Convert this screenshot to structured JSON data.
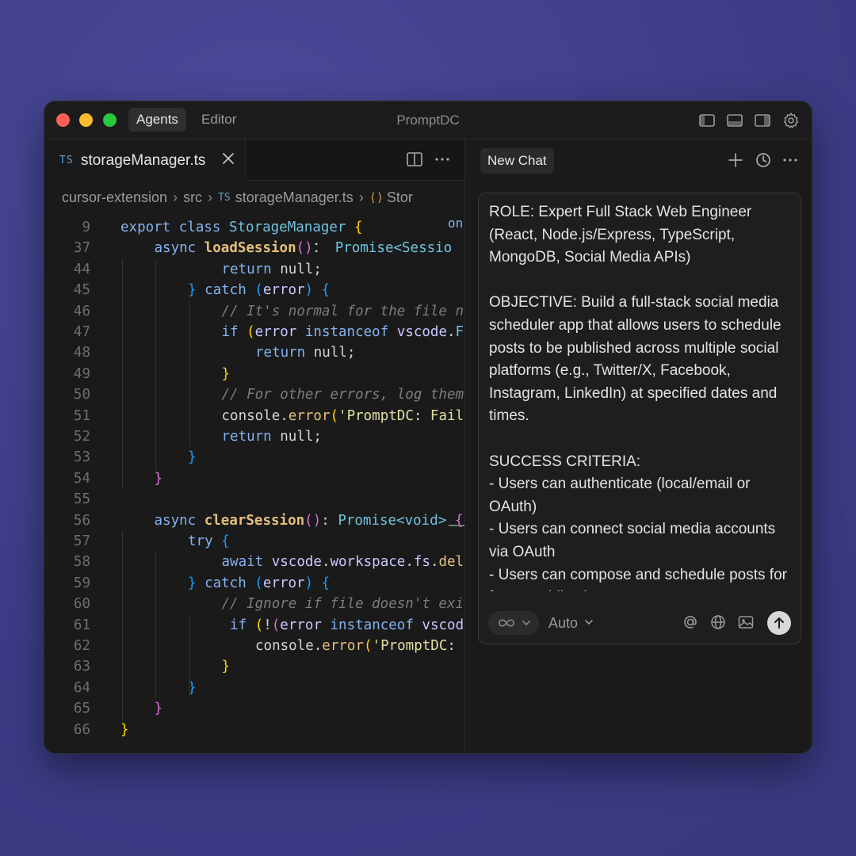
{
  "window": {
    "tabs": [
      "Agents",
      "Editor"
    ],
    "title": "PromptDC",
    "titlebar_icons": [
      "sidebar-left-icon",
      "panel-bottom-icon",
      "sidebar-right-icon",
      "gear-icon"
    ]
  },
  "editor": {
    "file_tab": {
      "badge": "TS",
      "label": "storageManager.ts"
    },
    "breadcrumb": [
      "cursor-extension",
      "src",
      "storageManager.ts",
      "Stor"
    ],
    "overflow_fragment": "on",
    "lines": [
      {
        "n": "9",
        "indent": 0,
        "tokens": [
          [
            "kw",
            "export class "
          ],
          [
            "ty",
            "StorageManager "
          ],
          [
            "br1",
            "{"
          ]
        ]
      },
      {
        "n": "37",
        "indent": 1,
        "tokens": [
          [
            "kw",
            "async "
          ],
          [
            "fn",
            "loadSession"
          ],
          [
            "br2",
            "()"
          ],
          [
            "",
            "："
          ],
          [
            "ty",
            " Promise<Sessio"
          ]
        ]
      },
      {
        "n": "44",
        "indent": 3,
        "tokens": [
          [
            "kw",
            "return "
          ],
          [
            "",
            "null;"
          ]
        ]
      },
      {
        "n": "45",
        "indent": 2,
        "tokens": [
          [
            "br3",
            "} "
          ],
          [
            "kw",
            "catch "
          ],
          [
            "br3",
            "("
          ],
          [
            "mem",
            "error"
          ],
          [
            "br3",
            ") {"
          ]
        ]
      },
      {
        "n": "46",
        "indent": 3,
        "tokens": [
          [
            "cm",
            "// It's normal for the file n"
          ]
        ]
      },
      {
        "n": "47",
        "indent": 3,
        "tokens": [
          [
            "kw",
            "if "
          ],
          [
            "br1",
            "("
          ],
          [
            "mem",
            "error "
          ],
          [
            "kw",
            "instanceof "
          ],
          [
            "mem",
            "vscode"
          ],
          [
            "",
            "."
          ],
          [
            "ty",
            "F"
          ]
        ]
      },
      {
        "n": "48",
        "indent": 4,
        "tokens": [
          [
            "kw",
            "return "
          ],
          [
            "",
            "null;"
          ]
        ]
      },
      {
        "n": "49",
        "indent": 3,
        "tokens": [
          [
            "br1",
            "}"
          ]
        ]
      },
      {
        "n": "50",
        "indent": 3,
        "tokens": [
          [
            "cm",
            "// For other errors, log them"
          ]
        ]
      },
      {
        "n": "51",
        "indent": 3,
        "tokens": [
          [
            "",
            "console."
          ],
          [
            "call",
            "error"
          ],
          [
            "br1",
            "("
          ],
          [
            "str",
            "'PromptDC: Fail"
          ]
        ]
      },
      {
        "n": "52",
        "indent": 3,
        "tokens": [
          [
            "kw",
            "return "
          ],
          [
            "",
            "null;"
          ]
        ]
      },
      {
        "n": "53",
        "indent": 2,
        "tokens": [
          [
            "br3",
            "}"
          ]
        ]
      },
      {
        "n": "54",
        "indent": 1,
        "tokens": [
          [
            "br2",
            "}"
          ]
        ]
      },
      {
        "n": "55",
        "indent": 0,
        "tokens": []
      },
      {
        "n": "56",
        "indent": 1,
        "tokens": [
          [
            "kw",
            "async "
          ],
          [
            "fn",
            "clearSession"
          ],
          [
            "br2",
            "()"
          ],
          [
            "",
            ": "
          ],
          [
            "ty",
            "Promise<void> "
          ],
          [
            "br2",
            "{"
          ]
        ]
      },
      {
        "n": "57",
        "indent": 2,
        "tokens": [
          [
            "kw",
            "try "
          ],
          [
            "br3",
            "{"
          ]
        ]
      },
      {
        "n": "58",
        "indent": 3,
        "tokens": [
          [
            "kw",
            "await "
          ],
          [
            "mem",
            "vscode"
          ],
          [
            "",
            "."
          ],
          [
            "mem",
            "workspace"
          ],
          [
            "",
            "."
          ],
          [
            "mem",
            "fs"
          ],
          [
            "",
            "."
          ],
          [
            "call",
            "del"
          ]
        ]
      },
      {
        "n": "59",
        "indent": 2,
        "tokens": [
          [
            "br3",
            "} "
          ],
          [
            "kw",
            "catch "
          ],
          [
            "br3",
            "("
          ],
          [
            "mem",
            "error"
          ],
          [
            "br3",
            ") {"
          ]
        ]
      },
      {
        "n": "60",
        "indent": 3,
        "tokens": [
          [
            "cm",
            "// Ignore if file doesn't exi"
          ]
        ]
      },
      {
        "n": "61",
        "indent": 3,
        "tokens": [
          [
            "kw",
            " if "
          ],
          [
            "br1",
            "("
          ],
          [
            "",
            "!"
          ],
          [
            "br2",
            "("
          ],
          [
            "mem",
            "error "
          ],
          [
            "kw",
            "instanceof "
          ],
          [
            "mem",
            "vscod"
          ]
        ]
      },
      {
        "n": "62",
        "indent": 4,
        "tokens": [
          [
            "",
            "console."
          ],
          [
            "call",
            "error"
          ],
          [
            "br1",
            "("
          ],
          [
            "str",
            "'PromptDC:"
          ]
        ]
      },
      {
        "n": "63",
        "indent": 3,
        "tokens": [
          [
            "br1",
            "}"
          ]
        ]
      },
      {
        "n": "64",
        "indent": 2,
        "tokens": [
          [
            "br3",
            "}"
          ]
        ]
      },
      {
        "n": "65",
        "indent": 1,
        "tokens": [
          [
            "br2",
            "}"
          ]
        ]
      },
      {
        "n": "66",
        "indent": 0,
        "tokens": [
          [
            "br1",
            "}"
          ]
        ]
      }
    ]
  },
  "chat": {
    "tab_label": "New Chat",
    "header_icons": [
      "plus-icon",
      "history-icon",
      "more-icon"
    ],
    "prompt_text": "ROLE: Expert Full Stack Web Engineer (React, Node.js/Express, TypeScript, MongoDB, Social Media APIs)\n\nOBJECTIVE: Build a full-stack social media scheduler app that allows users to schedule posts to be published across multiple social platforms (e.g., Twitter/X, Facebook, Instagram, LinkedIn) at specified dates and times.\n\nSUCCESS CRITERIA:\n- Users can authenticate (local/email or OAuth)\n- Users can connect social media accounts via OAuth\n- Users can compose and schedule posts for future publication",
    "mode_label": "Auto",
    "bottom_icons": [
      "at-icon",
      "globe-icon",
      "image-icon",
      "send-arrow-icon"
    ]
  }
}
